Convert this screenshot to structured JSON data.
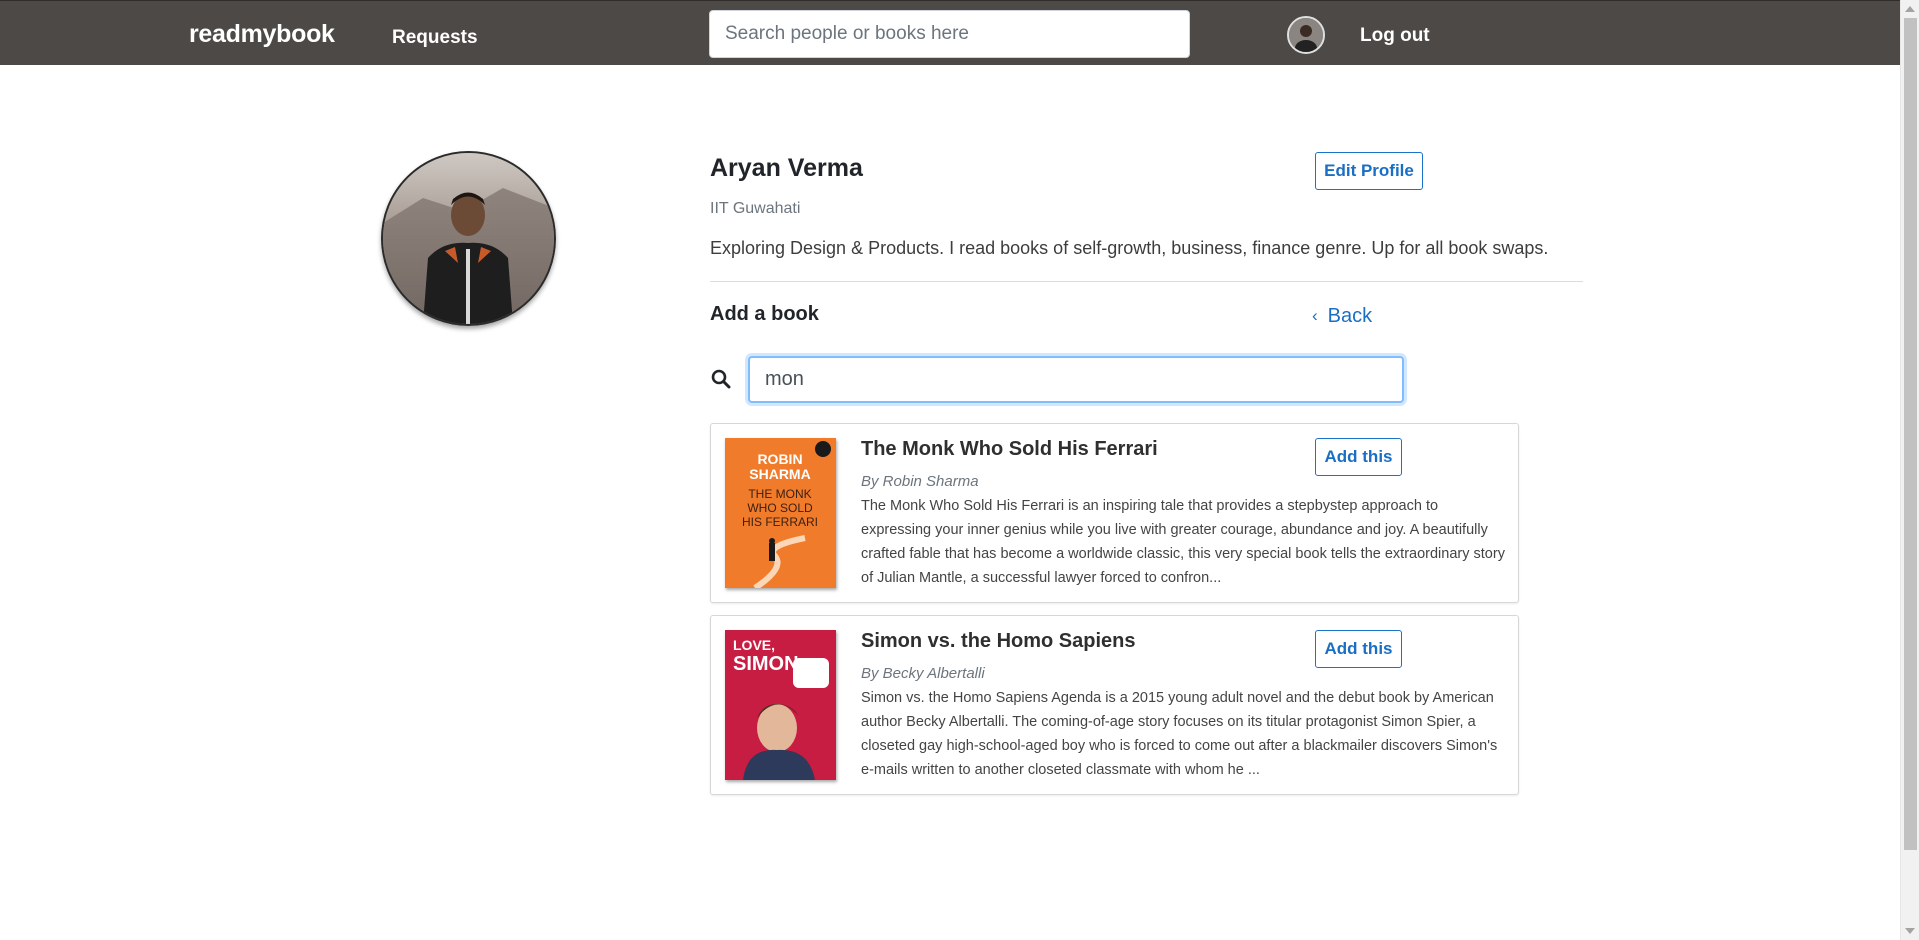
{
  "navbar": {
    "brand": "readmybook",
    "requests_label": "Requests",
    "search_placeholder": "Search people or books here",
    "logout_label": "Log out"
  },
  "profile": {
    "name": "Aryan Verma",
    "college": "IIT Guwahati",
    "bio": "Exploring Design & Products. I read books of self-growth, business, finance genre. Up for all book swaps.",
    "edit_label": "Edit Profile"
  },
  "add_book": {
    "heading": "Add a book",
    "back_label": "Back",
    "search_value": "mon"
  },
  "results": [
    {
      "title": "The Monk Who Sold His Ferrari",
      "author": "By Robin Sharma",
      "description": "The Monk Who Sold His Ferrari is an inspiring tale that provides a stepbystep approach to expressing your inner genius while you live with greater courage, abundance and joy. A beautifully crafted fable that has become a worldwide classic, this very special book tells the extraordinary story of Julian Mantle, a successful lawyer forced to confron...",
      "add_label": "Add this",
      "cover_lines": [
        "ROBIN",
        "SHARMA",
        "THE MONK",
        "WHO SOLD",
        "HIS FERRARI"
      ],
      "cover_color": "#f07b2a"
    },
    {
      "title": "Simon vs. the Homo Sapiens",
      "author": "By Becky Albertalli",
      "description": "Simon vs. the Homo Sapiens Agenda is a 2015 young adult novel and the debut book by American author Becky Albertalli. The coming-of-age story focuses on its titular protagonist Simon Spier, a closeted gay high-school-aged boy who is forced to come out after a blackmailer discovers Simon's e-mails written to another closeted classmate with whom he ...",
      "add_label": "Add this",
      "cover_lines": [
        "LOVE,",
        "SIMON"
      ],
      "cover_color": "#c81d42"
    }
  ],
  "colors": {
    "navbar_bg": "#4d4946",
    "accent": "#1a6fc4"
  }
}
